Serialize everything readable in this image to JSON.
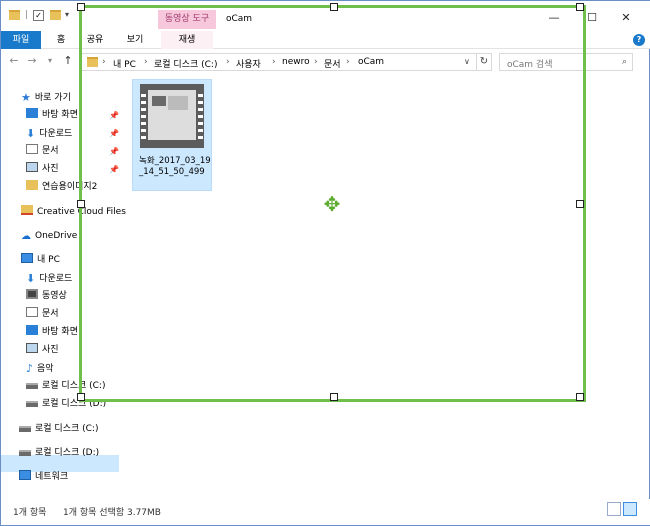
{
  "window": {
    "title": "oCam",
    "context_tab_group": "동영상 도구",
    "controls": {
      "minimize": "—",
      "maximize": "☐",
      "close": "✕"
    }
  },
  "ribbon": {
    "tabs": [
      "파일",
      "홈",
      "공유",
      "보기",
      "재생"
    ],
    "help": "?"
  },
  "address": {
    "crumbs": [
      "내 PC",
      "로컬 디스크 (C:)",
      "사용자",
      "newro",
      "문서",
      "oCam"
    ],
    "search_placeholder": "oCam 검색"
  },
  "nav": {
    "quick_access": "바로 가기",
    "quick_items": [
      "바탕 화면",
      "다운로드",
      "문서",
      "사진",
      "연습용이미지2"
    ],
    "creative_cloud": "Creative Cloud Files",
    "onedrive": "OneDrive",
    "this_pc": "내 PC",
    "pc_items": [
      "다운로드",
      "동영상",
      "문서",
      "바탕 화면",
      "사진",
      "음악",
      "로컬 디스크 (C:)",
      "로컬 디스크 (D:)"
    ],
    "drive_c": "로컬 디스크 (C:)",
    "drive_d": "로컬 디스크 (D:)",
    "network": "네트워크"
  },
  "file": {
    "name": "녹화_2017_03_19_14_51_50_499"
  },
  "status": {
    "count": "1개 항목",
    "selected": "1개 항목 선택함 3.77MB"
  },
  "colors": {
    "accent": "#1979ca",
    "capture_frame": "#6fbf4a",
    "selection": "#cce8ff",
    "context_tab": "#f7c8dc"
  }
}
